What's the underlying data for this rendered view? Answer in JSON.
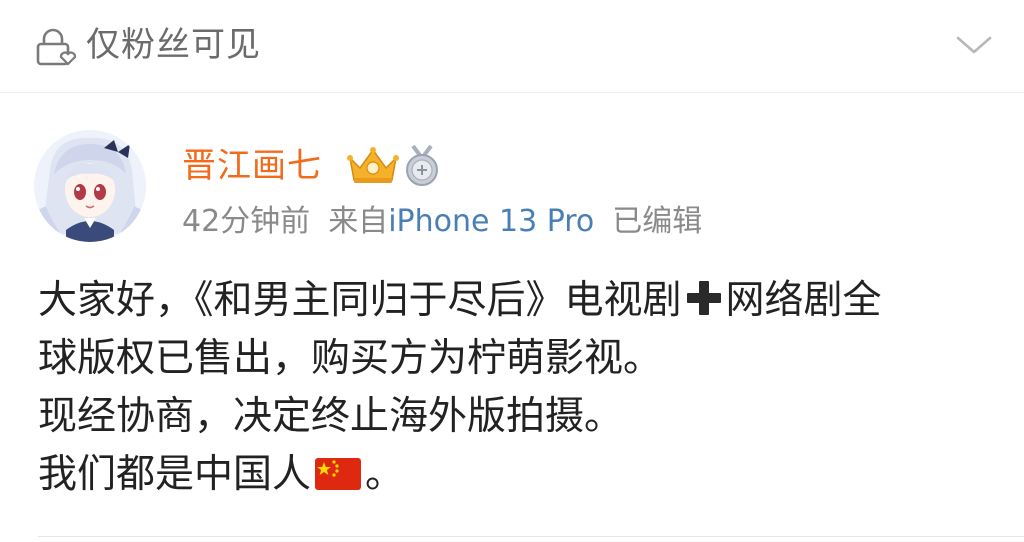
{
  "visibility": {
    "label": "仅粉丝可见",
    "icon": "lock-icon",
    "expand_icon": "chevron-down-icon"
  },
  "post": {
    "author": {
      "name": "晋江画七",
      "avatar_icon": "anime-avatar",
      "badges": [
        "crown-badge-icon",
        "medal-badge-icon"
      ],
      "name_color": "#f26b1d"
    },
    "meta": {
      "time": "42分钟前",
      "source_prefix": "来自",
      "source_device": "iPhone 13 Pro",
      "edited": "已编辑"
    },
    "content": {
      "line1_a": "大家好，《和男主同归于尽后》电视剧",
      "line1_b": "网络剧全",
      "line2": "球版权已售出，购买方为柠萌影视。",
      "line3": "现经协商，决定终止海外版拍摄。",
      "line4_a": "我们都是中国人",
      "line4_b": "。",
      "emojis": [
        "heavy-plus-icon",
        "china-flag-icon"
      ]
    }
  },
  "colors": {
    "author": "#f26b1d",
    "source_link": "#4a7fb5",
    "meta": "#8a8a8a",
    "body_text": "#222222"
  }
}
